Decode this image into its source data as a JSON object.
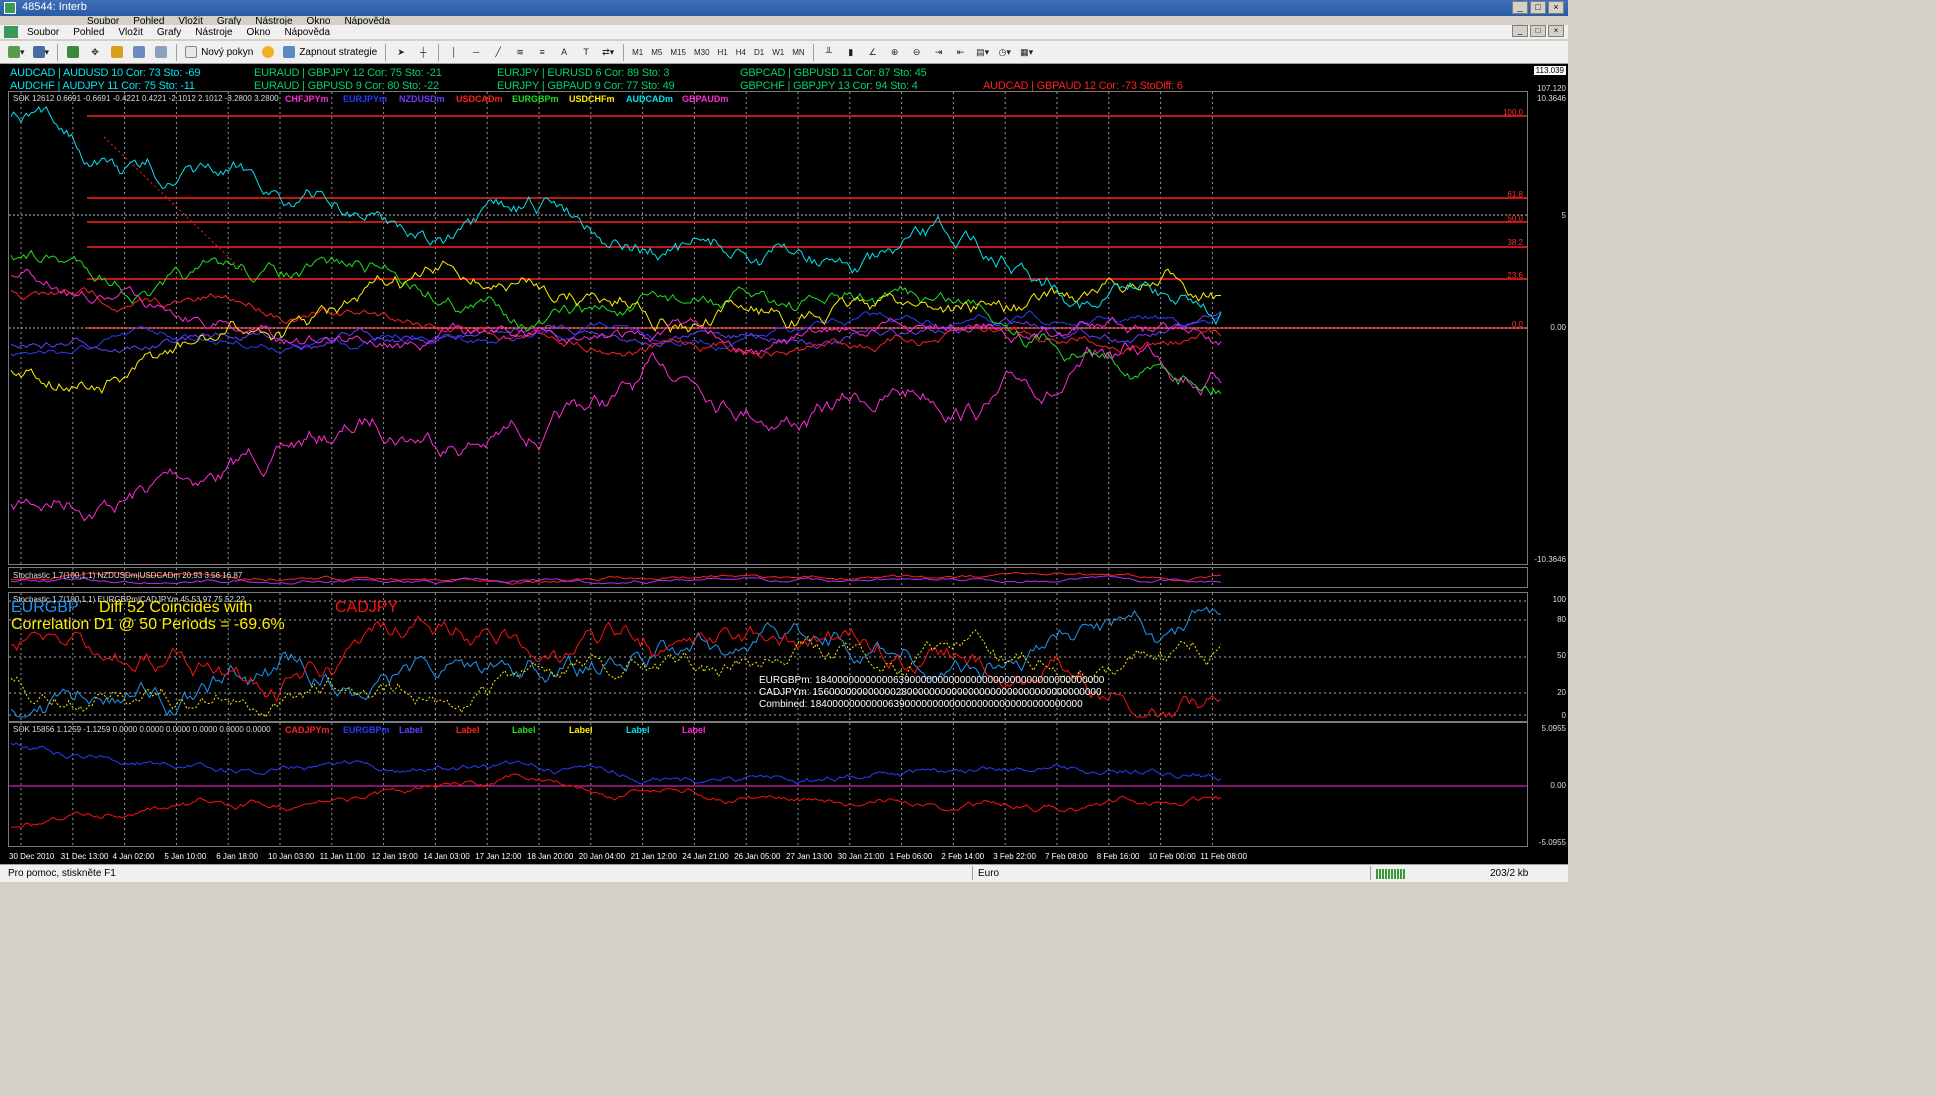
{
  "window": {
    "title": "48544: Interb"
  },
  "menu_top": [
    "Soubor",
    "Pohled",
    "Vložit",
    "Grafy",
    "Nástroje",
    "Okno",
    "Nápověda"
  ],
  "menu": [
    "Soubor",
    "Pohled",
    "Vložit",
    "Grafy",
    "Nástroje",
    "Okno",
    "Nápověda"
  ],
  "toolbar": {
    "new_order": "Nový pokyn",
    "strategy": "Zapnout strategie",
    "timeframes": [
      "M1",
      "M5",
      "M15",
      "M30",
      "H1",
      "H4",
      "D1",
      "W1",
      "MN"
    ]
  },
  "correlations": {
    "row1": [
      {
        "text": "AUDCAD | AUDUSD  10   Cor: 73   Sto:  -69",
        "color": "#00e5ee"
      },
      {
        "text": "EURAUD | GBPJPY  12   Cor: 75   Sto:  -21",
        "color": "#00d26a"
      },
      {
        "text": "EURJPY | EURUSD  6   Cor: 89   Sto:  3",
        "color": "#00d26a"
      },
      {
        "text": "GBPCAD | GBPUSD  11   Cor: 87   Sto:  45",
        "color": "#00d26a"
      }
    ],
    "row2": [
      {
        "text": "AUDCHF | AUDJPY  11   Cor: 75   Sto:  -11",
        "color": "#00e5ee"
      },
      {
        "text": "EURAUD | GBPUSD  9   Cor: 80   Sto:  -22",
        "color": "#00d26a"
      },
      {
        "text": "EURJPY | GBPAUD  9   Cor: 77   Sto:  49",
        "color": "#00d26a"
      },
      {
        "text": "GBPCHF | GBPJPY  13   Cor: 94   Sto:  4",
        "color": "#00d26a"
      },
      {
        "text": "AUDCAD | GBPAUD  12   Cor: -73   StoDiff:  6",
        "color": "#ff1f1f"
      }
    ]
  },
  "pane1": {
    "label": "SOK 12612 0.6691 -0.6691 -0.4221 0.4221 -2.1012 2.1012 -3.2800 3.2800",
    "legend": [
      {
        "text": "CHFJPYm",
        "color": "#ff2bd6"
      },
      {
        "text": "EURJPYm",
        "color": "#2a3cff"
      },
      {
        "text": "NZDUSDm",
        "color": "#6a3cff"
      },
      {
        "text": "USDCADm",
        "color": "#ff2020"
      },
      {
        "text": "EURGBPm",
        "color": "#20e020"
      },
      {
        "text": "USDCHFm",
        "color": "#ffee00"
      },
      {
        "text": "AUDCADm",
        "color": "#00e5ee"
      },
      {
        "text": "GBPAUDm",
        "color": "#ff2bd6"
      }
    ],
    "scale": {
      "top": "113.039",
      "second": "107.120",
      "upper": "10.3646",
      "five": "5",
      "zero": "0.00",
      "lower": "-10.3646"
    },
    "fib_labels": [
      "100.0",
      "61.8",
      "50.0",
      "38.2",
      "23.6",
      "0.0"
    ]
  },
  "pane2": {
    "label": "Stochastic 1.7(100,1,1) NZDUSDm|USDCADm 20.93 3.56 16.87"
  },
  "pane3": {
    "label": "Stochastic 1.7(100,1,1) EURGBPm|CADJPYm 45.53 97.75 52.22",
    "pair1": "EURGBP",
    "diff_text": "Diff 52 Coincides with",
    "pair2": "CADJPY",
    "corr_text": "Correlation D1 @ 50 Periods = -69.6%",
    "lines": [
      "EURGBPm: 1840000000000063900000000000000000000000000000000000",
      "CADJPYm: 1560000000000002800000000000000000000000000000000000",
      "Combined: 1840000000000063900000000000000000000000000000000"
    ],
    "scale": [
      "100",
      "80",
      "50",
      "20",
      "0"
    ]
  },
  "pane4": {
    "label": "SOK 15856 1.1259 -1.1259 0.0000 0.0000 0.0000 0.0000 0.0000 0.0000",
    "legend": [
      {
        "text": "CADJPYm",
        "color": "#ff2020"
      },
      {
        "text": "EURGBPm",
        "color": "#2a3cff"
      },
      {
        "text": "Label",
        "color": "#6a3cff"
      },
      {
        "text": "Label",
        "color": "#ff2020"
      },
      {
        "text": "Label",
        "color": "#20e020"
      },
      {
        "text": "Label",
        "color": "#ffee00"
      },
      {
        "text": "Label",
        "color": "#00e5ee"
      },
      {
        "text": "Label",
        "color": "#ff2bd6"
      }
    ],
    "scale": {
      "top": "5.0955",
      "zero": "0.00",
      "bottom": "-5.0955"
    }
  },
  "xaxis": [
    "30 Dec 2010",
    "31 Dec 13:00",
    "4 Jan 02:00",
    "5 Jan 10:00",
    "6 Jan 18:00",
    "10 Jan 03:00",
    "11 Jan 11:00",
    "12 Jan 19:00",
    "14 Jan 03:00",
    "17 Jan 12:00",
    "18 Jan 20:00",
    "20 Jan 04:00",
    "21 Jan 12:00",
    "24 Jan 21:00",
    "26 Jan 05:00",
    "27 Jan 13:00",
    "30 Jan 21:00",
    "1 Feb 06:00",
    "2 Feb 14:00",
    "3 Feb 22:00",
    "7 Feb 08:00",
    "8 Feb 16:00",
    "10 Feb 00:00",
    "11 Feb 08:00"
  ],
  "status": {
    "help": "Pro pomoc, stiskněte F1",
    "profile": "Euro",
    "traffic": "203/2 kb"
  }
}
